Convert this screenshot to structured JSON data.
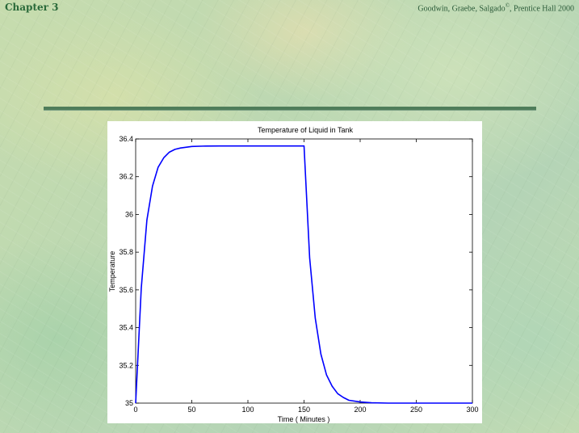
{
  "header": {
    "chapter": "Chapter 3",
    "credit": "Goodwin, Graebe, Salgado",
    "credit_mark": "©",
    "credit_tail": ", Prentice Hall 2000"
  },
  "colors": {
    "line": "#0000ff",
    "rule": "#4f7d5a",
    "heading": "#2a6a3a"
  },
  "chart_data": {
    "type": "line",
    "title": "Temperature of Liquid in Tank",
    "xlabel": "Time ( Minutes )",
    "ylabel": "Temperature",
    "xlim": [
      0,
      300
    ],
    "ylim": [
      35,
      36.4
    ],
    "xticks": [
      0,
      50,
      100,
      150,
      200,
      250,
      300
    ],
    "yticks": [
      35,
      35.2,
      35.4,
      35.6,
      35.8,
      36,
      36.2,
      36.4
    ],
    "xtick_labels": [
      "0",
      "50",
      "100",
      "150",
      "200",
      "250",
      "300"
    ],
    "ytick_labels": [
      "35",
      "35.2",
      "35.4",
      "35.6",
      "35.8",
      "36",
      "36.2",
      "36.4"
    ],
    "grid": false,
    "series": [
      {
        "x": [
          0,
          5,
          10,
          15,
          20,
          25,
          30,
          35,
          40,
          50,
          60,
          75,
          100,
          125,
          150,
          155,
          160,
          165,
          170,
          175,
          180,
          185,
          190,
          200,
          210,
          225,
          250,
          275,
          300
        ],
        "y": [
          35.0,
          35.61,
          35.97,
          36.15,
          36.25,
          36.3,
          36.33,
          36.345,
          36.352,
          36.36,
          36.362,
          36.363,
          36.363,
          36.363,
          36.363,
          35.77,
          35.45,
          35.26,
          35.15,
          35.09,
          35.05,
          35.03,
          35.015,
          35.006,
          35.002,
          35.0,
          35.0,
          35.0,
          35.0
        ]
      }
    ]
  }
}
